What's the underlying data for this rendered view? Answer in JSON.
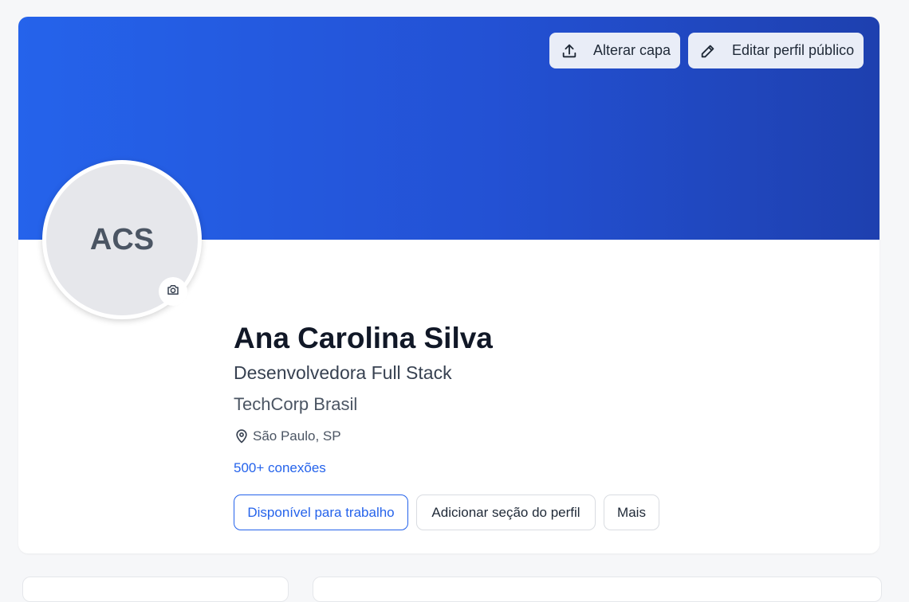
{
  "cover": {
    "change_cover_label": "Alterar capa",
    "edit_profile_label": "Editar perfil público",
    "gradient_colors": [
      "#2563eb",
      "#1e40af"
    ]
  },
  "avatar": {
    "initials": "ACS"
  },
  "profile": {
    "name": "Ana Carolina Silva",
    "headline": "Desenvolvedora Full Stack",
    "company": "TechCorp Brasil",
    "location": "São Paulo, SP",
    "connections": "500+ conexões"
  },
  "actions": {
    "open_to_work": "Disponível para trabalho",
    "add_section": "Adicionar seção do perfil",
    "more": "Mais"
  },
  "icons": {
    "upload": "upload-icon",
    "edit": "pencil-icon",
    "camera": "camera-icon",
    "location": "map-pin-icon"
  },
  "colors": {
    "accent": "#2563eb",
    "text": "#111827",
    "muted": "#4b5563"
  }
}
